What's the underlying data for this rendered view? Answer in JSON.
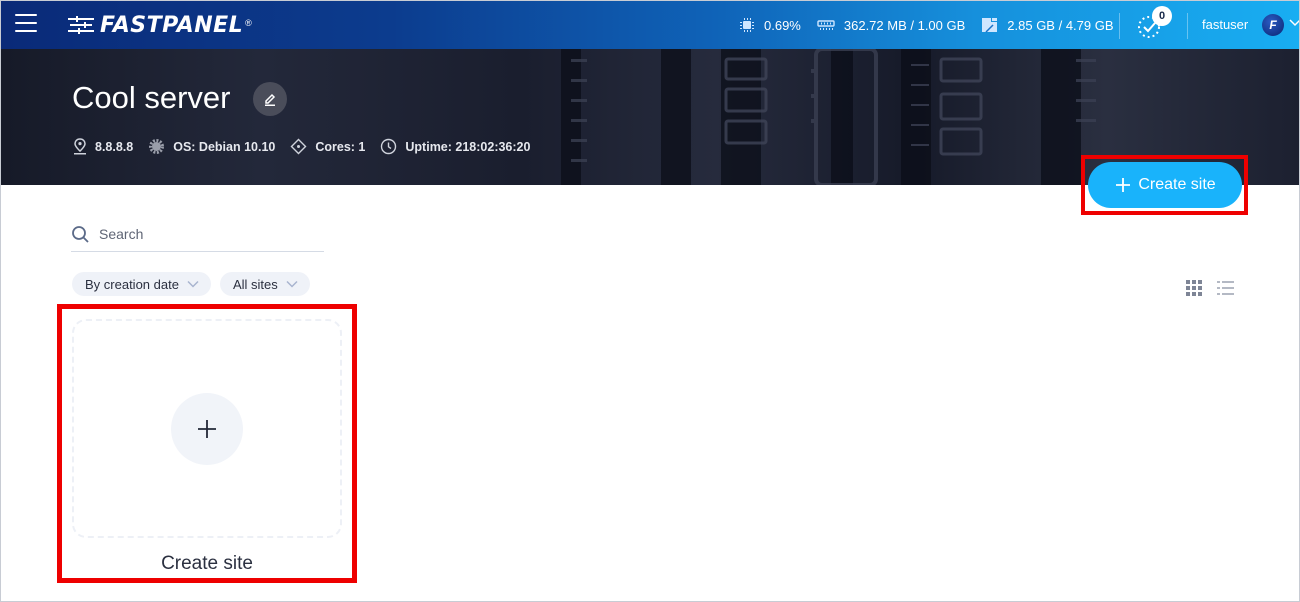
{
  "topbar": {
    "logo_text": "FASTPANEL",
    "logo_reg": "®",
    "stats": {
      "cpu": "0.69%",
      "memory": "362.72 MB / 1.00 GB",
      "disk": "2.85 GB / 4.79 GB"
    },
    "tasks_count": "0",
    "username": "fastuser",
    "avatar_letter": "F"
  },
  "server": {
    "title": "Cool server",
    "ip": "8.8.8.8",
    "os": "OS: Debian 10.10",
    "cores": "Cores: 1",
    "uptime": "Uptime: 218:02:36:20"
  },
  "actions": {
    "create_site_label": "Create site"
  },
  "search": {
    "placeholder": "Search",
    "value": ""
  },
  "filters": {
    "sort": "By creation date",
    "scope": "All sites"
  },
  "card": {
    "label": "Create site"
  },
  "colors": {
    "accent": "#19b3fb",
    "highlight": "#ee0000"
  }
}
